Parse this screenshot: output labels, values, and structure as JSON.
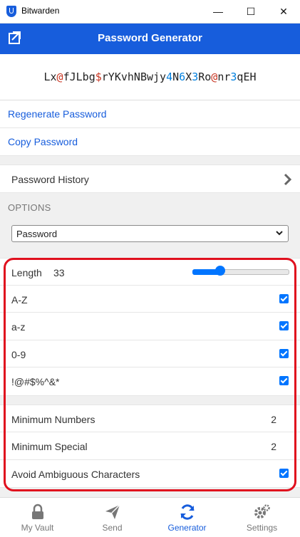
{
  "window": {
    "title": "Bitwarden",
    "min": "—",
    "max": "☐",
    "close": "✕"
  },
  "header": {
    "title": "Password Generator"
  },
  "password": {
    "segments": [
      {
        "t": "Lx",
        "k": "l"
      },
      {
        "t": "@",
        "k": "s"
      },
      {
        "t": "fJLbg",
        "k": "l"
      },
      {
        "t": "$",
        "k": "s"
      },
      {
        "t": "rYKvhNBwjy",
        "k": "l"
      },
      {
        "t": "4",
        "k": "n"
      },
      {
        "t": "N",
        "k": "l"
      },
      {
        "t": "6",
        "k": "n"
      },
      {
        "t": "X",
        "k": "l"
      },
      {
        "t": "3",
        "k": "n"
      },
      {
        "t": "Ro",
        "k": "l"
      },
      {
        "t": "@",
        "k": "s"
      },
      {
        "t": "nr",
        "k": "l"
      },
      {
        "t": "3",
        "k": "n"
      },
      {
        "t": "qEH",
        "k": "l"
      }
    ]
  },
  "actions": {
    "regenerate": "Regenerate Password",
    "copy": "Copy Password"
  },
  "history": {
    "label": "Password History"
  },
  "options": {
    "section": "OPTIONS",
    "type_selected": "Password"
  },
  "length": {
    "label": "Length",
    "value": "33",
    "slider_fraction": 0.29
  },
  "toggles": {
    "upper": "A-Z",
    "lower": "a-z",
    "digits": "0-9",
    "special": "!@#$%^&*"
  },
  "minimums": {
    "numbers_label": "Minimum Numbers",
    "numbers_value": "2",
    "special_label": "Minimum Special",
    "special_value": "2",
    "ambiguous_label": "Avoid Ambiguous Characters"
  },
  "tabs": {
    "vault": "My Vault",
    "send": "Send",
    "generator": "Generator",
    "settings": "Settings"
  },
  "colors": {
    "brand": "#175ddc",
    "number": "#007fde",
    "special": "#c83522",
    "highlight": "#e0101e"
  }
}
